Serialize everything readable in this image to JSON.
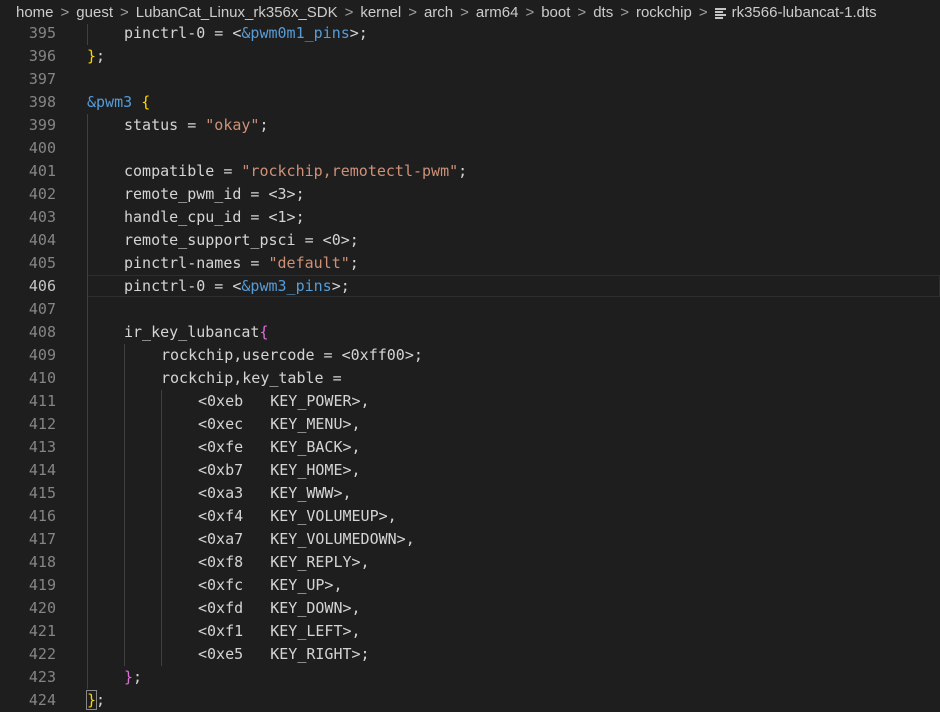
{
  "breadcrumb": {
    "items": [
      "home",
      "guest",
      "LubanCat_Linux_rk356x_SDK",
      "kernel",
      "arch",
      "arm64",
      "boot",
      "dts",
      "rockchip"
    ],
    "file": "rk3566-lubancat-1.dts",
    "separator": ">"
  },
  "editor": {
    "current_line": "406",
    "lines": [
      {
        "n": "395",
        "indent": 1,
        "parts": [
          [
            "p",
            "pinctrl-0 = <"
          ],
          [
            "r",
            "&pwm0m1_pins"
          ],
          [
            "p",
            ">;"
          ]
        ]
      },
      {
        "n": "396",
        "indent": 0,
        "parts": [
          [
            "b",
            "}"
          ],
          [
            "p",
            ";"
          ]
        ]
      },
      {
        "n": "397",
        "indent": 0,
        "parts": []
      },
      {
        "n": "398",
        "indent": 0,
        "parts": [
          [
            "r",
            "&pwm3"
          ],
          [
            "p",
            " "
          ],
          [
            "b",
            "{"
          ]
        ]
      },
      {
        "n": "399",
        "indent": 1,
        "parts": [
          [
            "p",
            "status = "
          ],
          [
            "s",
            "\"okay\""
          ],
          [
            "p",
            ";"
          ]
        ]
      },
      {
        "n": "400",
        "indent": 0,
        "parts": []
      },
      {
        "n": "401",
        "indent": 1,
        "parts": [
          [
            "p",
            "compatible = "
          ],
          [
            "s",
            "\"rockchip,remotectl-pwm\""
          ],
          [
            "p",
            ";"
          ]
        ]
      },
      {
        "n": "402",
        "indent": 1,
        "parts": [
          [
            "p",
            "remote_pwm_id = <3>;"
          ]
        ]
      },
      {
        "n": "403",
        "indent": 1,
        "parts": [
          [
            "p",
            "handle_cpu_id = <1>;"
          ]
        ]
      },
      {
        "n": "404",
        "indent": 1,
        "parts": [
          [
            "p",
            "remote_support_psci = <0>;"
          ]
        ]
      },
      {
        "n": "405",
        "indent": 1,
        "parts": [
          [
            "p",
            "pinctrl-names = "
          ],
          [
            "s",
            "\"default\""
          ],
          [
            "p",
            ";"
          ]
        ]
      },
      {
        "n": "406",
        "indent": 1,
        "parts": [
          [
            "p",
            "pinctrl-0 = <"
          ],
          [
            "r",
            "&pwm3_pins"
          ],
          [
            "p",
            ">;"
          ]
        ]
      },
      {
        "n": "407",
        "indent": 0,
        "parts": []
      },
      {
        "n": "408",
        "indent": 1,
        "parts": [
          [
            "p",
            "ir_key_lubancat"
          ],
          [
            "b2",
            "{"
          ]
        ]
      },
      {
        "n": "409",
        "indent": 2,
        "parts": [
          [
            "p",
            "rockchip,usercode = <0xff00>;"
          ]
        ]
      },
      {
        "n": "410",
        "indent": 2,
        "parts": [
          [
            "p",
            "rockchip,key_table ="
          ]
        ]
      },
      {
        "n": "411",
        "indent": 3,
        "parts": [
          [
            "p",
            "<0xeb   KEY_POWER>,"
          ]
        ]
      },
      {
        "n": "412",
        "indent": 3,
        "parts": [
          [
            "p",
            "<0xec   KEY_MENU>,"
          ]
        ]
      },
      {
        "n": "413",
        "indent": 3,
        "parts": [
          [
            "p",
            "<0xfe   KEY_BACK>,"
          ]
        ]
      },
      {
        "n": "414",
        "indent": 3,
        "parts": [
          [
            "p",
            "<0xb7   KEY_HOME>,"
          ]
        ]
      },
      {
        "n": "415",
        "indent": 3,
        "parts": [
          [
            "p",
            "<0xa3   KEY_WWW>,"
          ]
        ]
      },
      {
        "n": "416",
        "indent": 3,
        "parts": [
          [
            "p",
            "<0xf4   KEY_VOLUMEUP>,"
          ]
        ]
      },
      {
        "n": "417",
        "indent": 3,
        "parts": [
          [
            "p",
            "<0xa7   KEY_VOLUMEDOWN>,"
          ]
        ]
      },
      {
        "n": "418",
        "indent": 3,
        "parts": [
          [
            "p",
            "<0xf8   KEY_REPLY>,"
          ]
        ]
      },
      {
        "n": "419",
        "indent": 3,
        "parts": [
          [
            "p",
            "<0xfc   KEY_UP>,"
          ]
        ]
      },
      {
        "n": "420",
        "indent": 3,
        "parts": [
          [
            "p",
            "<0xfd   KEY_DOWN>,"
          ]
        ]
      },
      {
        "n": "421",
        "indent": 3,
        "parts": [
          [
            "p",
            "<0xf1   KEY_LEFT>,"
          ]
        ]
      },
      {
        "n": "422",
        "indent": 3,
        "parts": [
          [
            "p",
            "<0xe5   KEY_RIGHT>;"
          ]
        ]
      },
      {
        "n": "423",
        "indent": 1,
        "parts": [
          [
            "b2",
            "}"
          ],
          [
            "p",
            ";"
          ]
        ]
      },
      {
        "n": "424",
        "indent": 0,
        "parts": [
          [
            "bx",
            "}"
          ],
          [
            "p",
            ";"
          ]
        ]
      }
    ]
  },
  "colors": {
    "background": "#1e1e1e",
    "text": "#d4d4d4",
    "string": "#ce9178",
    "reference": "#569cd6",
    "brace": "#ffd700",
    "brace_nested": "#da70d6",
    "line_number": "#858585"
  }
}
